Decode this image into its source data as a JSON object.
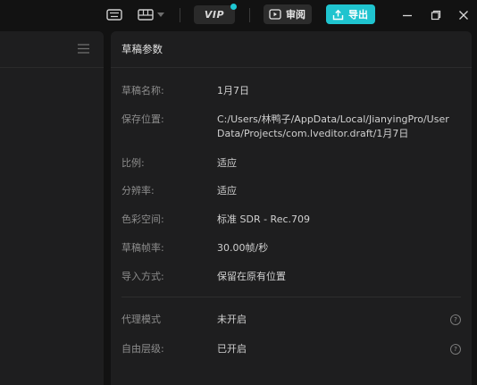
{
  "titlebar": {
    "vip_label": "VIP",
    "review_label": "审阅",
    "export_label": "导出",
    "accent": "#1fc4cf"
  },
  "panel": {
    "title": "草稿参数",
    "rows": [
      {
        "key": "草稿名称:",
        "value": "1月7日"
      },
      {
        "key": "保存位置:",
        "value": "C:/Users/林鸭子/AppData/Local/JianyingPro/User Data/Projects/com.lveditor.draft/1月7日"
      },
      {
        "key": "比例:",
        "value": "适应"
      },
      {
        "key": "分辨率:",
        "value": "适应"
      },
      {
        "key": "色彩空间:",
        "value": "标准 SDR - Rec.709"
      },
      {
        "key": "草稿帧率:",
        "value": "30.00帧/秒"
      },
      {
        "key": "导入方式:",
        "value": "保留在原有位置"
      },
      {
        "key": "代理模式",
        "value": "未开启"
      },
      {
        "key": "自由层级:",
        "value": "已开启"
      }
    ]
  }
}
